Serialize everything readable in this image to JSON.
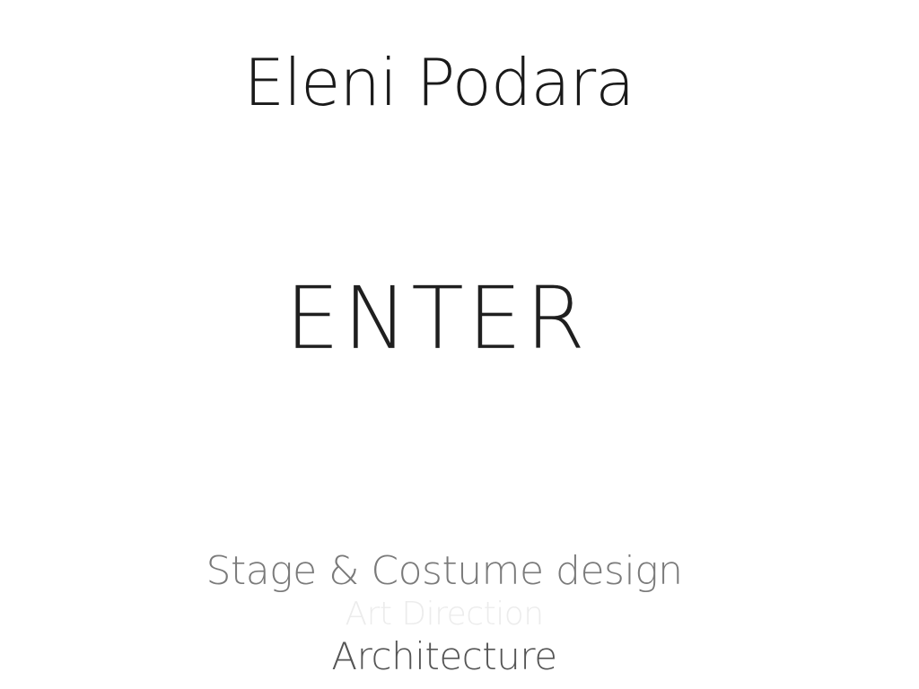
{
  "site": {
    "name": "Eleni Podara"
  },
  "entry": {
    "label": "ENTER"
  },
  "disciplines": [
    {
      "label": "Stage & Costume design"
    },
    {
      "label": "Art Direction"
    },
    {
      "label": "Architecture"
    }
  ],
  "colors": {
    "background": "#ffffff",
    "title": "#1a1a1a",
    "enter": "#1f1f1f",
    "discipline_stage": "#7a7a7a",
    "discipline_art": "#ececec",
    "discipline_arch": "#555555"
  }
}
